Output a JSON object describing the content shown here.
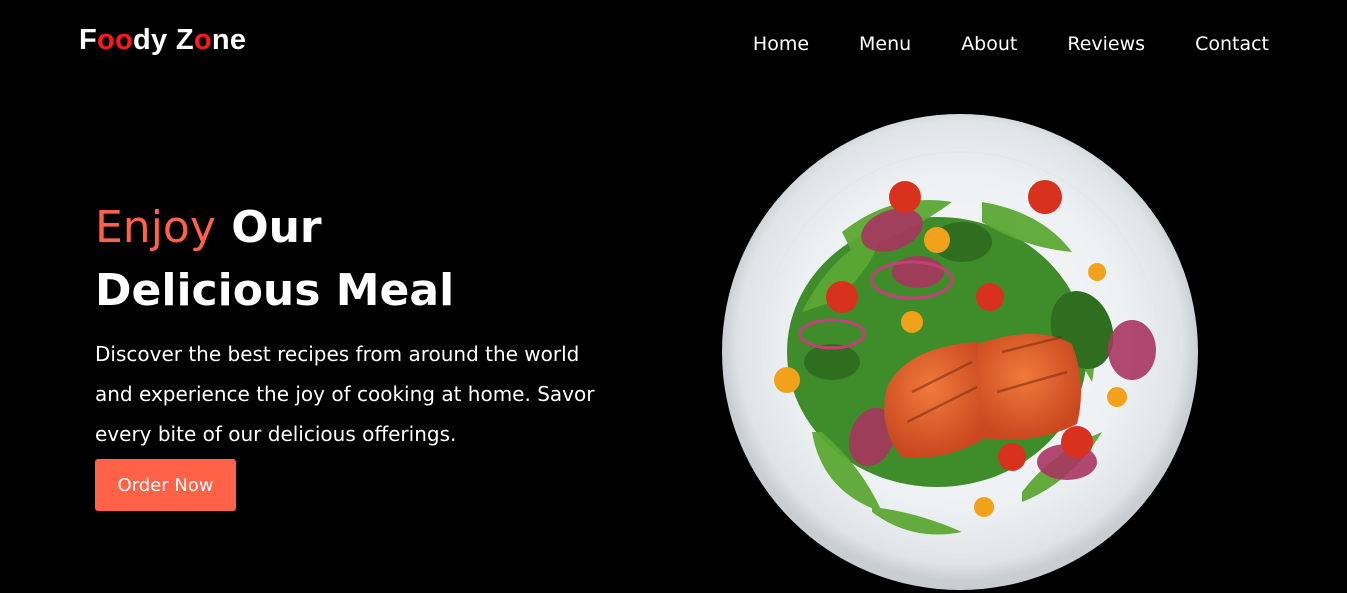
{
  "brand": {
    "parts": [
      {
        "text": "F",
        "accent": false
      },
      {
        "text": "oo",
        "accent": true
      },
      {
        "text": "dy Z",
        "accent": false
      },
      {
        "text": "o",
        "accent": true
      },
      {
        "text": "ne",
        "accent": false
      }
    ],
    "accent_color": "#ff1a1a"
  },
  "nav": {
    "items": [
      "Home",
      "Menu",
      "About",
      "Reviews",
      "Contact"
    ]
  },
  "hero": {
    "title_accent": "Enjoy",
    "title_rest": "Our",
    "title_line2": "Delicious Meal",
    "accent_color": "#ff6247",
    "description": "Discover the best recipes from around the world and experience the joy of cooking at home. Savor every bite of our delicious offerings.",
    "cta_label": "Order Now"
  },
  "image": {
    "subject": "salmon-salad-plate"
  }
}
